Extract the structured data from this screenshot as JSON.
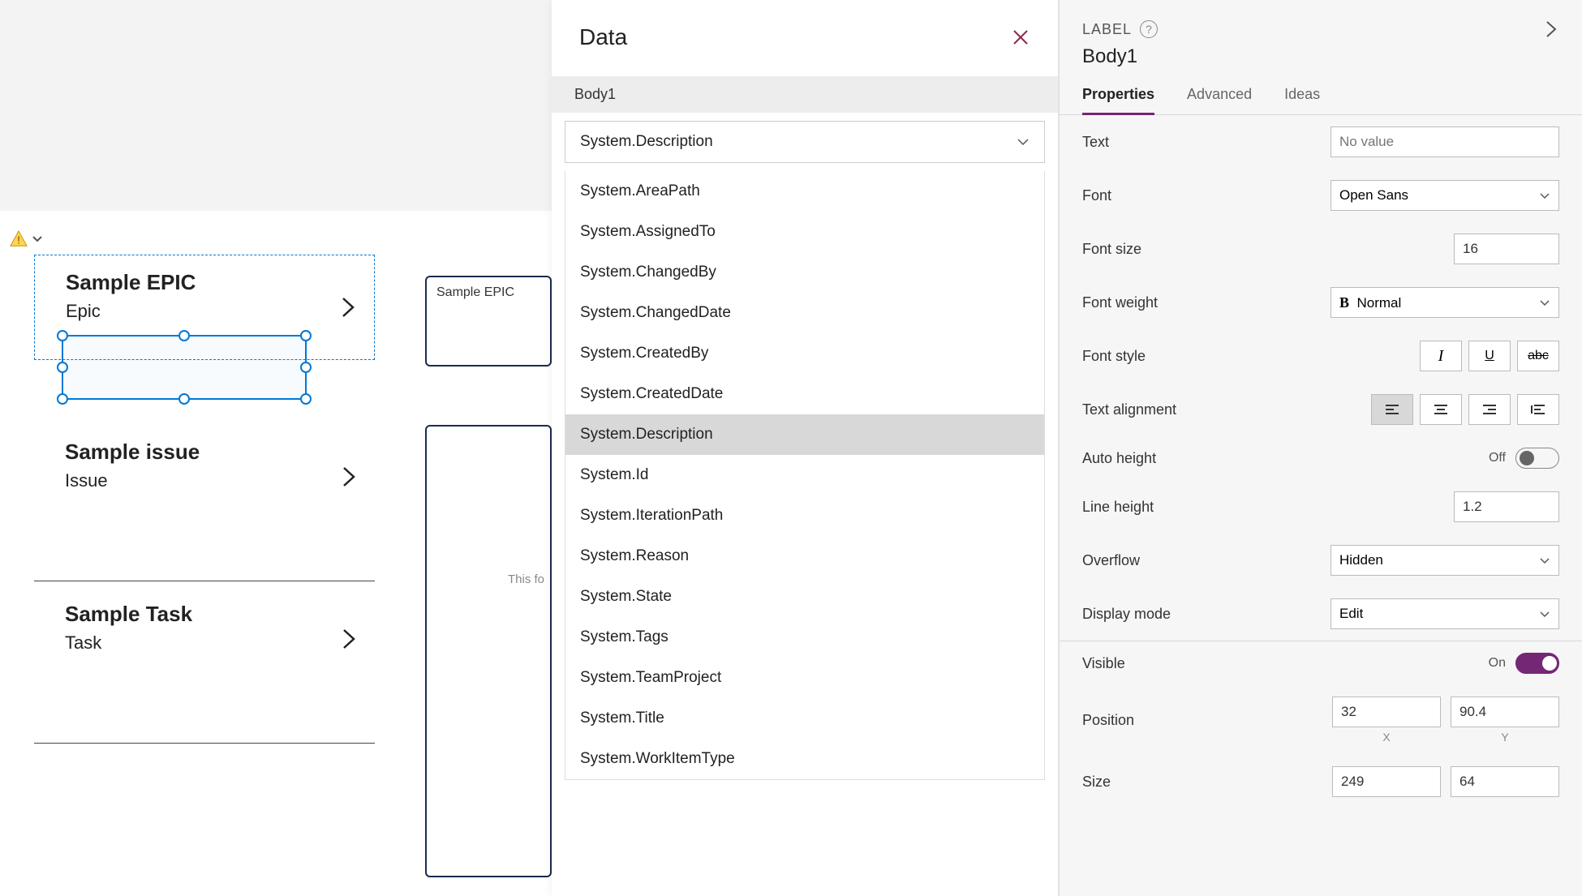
{
  "canvas": {
    "gallery": [
      {
        "title": "Sample EPIC",
        "subtitle": "Epic"
      },
      {
        "title": "Sample issue",
        "subtitle": "Issue"
      },
      {
        "title": "Sample Task",
        "subtitle": "Task"
      }
    ],
    "mid_card_title": "Sample EPIC",
    "mid_card_placeholder": "This fo"
  },
  "data_panel": {
    "title": "Data",
    "body_label": "Body1",
    "selected": "System.Description",
    "options": [
      "System.AreaPath",
      "System.AssignedTo",
      "System.ChangedBy",
      "System.ChangedDate",
      "System.CreatedBy",
      "System.CreatedDate",
      "System.Description",
      "System.Id",
      "System.IterationPath",
      "System.Reason",
      "System.State",
      "System.Tags",
      "System.TeamProject",
      "System.Title",
      "System.WorkItemType"
    ]
  },
  "props": {
    "label_header": "LABEL",
    "name": "Body1",
    "tabs": [
      "Properties",
      "Advanced",
      "Ideas"
    ],
    "active_tab": 0,
    "text_label": "Text",
    "text_value": "No value",
    "font_label": "Font",
    "font_value": "Open Sans",
    "font_size_label": "Font size",
    "font_size_value": "16",
    "font_weight_label": "Font weight",
    "font_weight_value": "Normal",
    "font_style_label": "Font style",
    "text_align_label": "Text alignment",
    "auto_height_label": "Auto height",
    "auto_height_value": "Off",
    "line_height_label": "Line height",
    "line_height_value": "1.2",
    "overflow_label": "Overflow",
    "overflow_value": "Hidden",
    "display_mode_label": "Display mode",
    "display_mode_value": "Edit",
    "visible_label": "Visible",
    "visible_value": "On",
    "position_label": "Position",
    "position_x": "32",
    "position_y": "90.4",
    "x_label": "X",
    "y_label": "Y",
    "size_label": "Size",
    "size_w": "249",
    "size_h": "64"
  }
}
